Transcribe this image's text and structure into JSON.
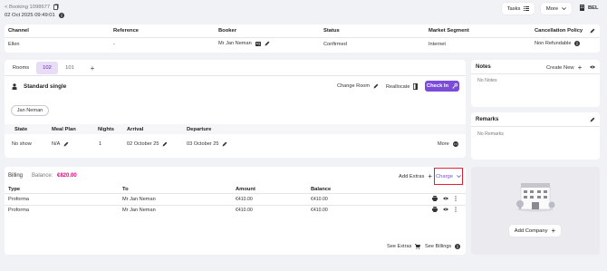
{
  "header": {
    "back_link": "< Booking 1098677",
    "datetime": "02 Oct 2025 09:49:01",
    "tasks_label": "Tasks",
    "more_label": "More",
    "lang": "BEL"
  },
  "summary": {
    "columns": [
      "Channel",
      "Reference",
      "Booker",
      "Status",
      "Market Segment",
      "Cancellation Policy"
    ],
    "values": {
      "channel": "Ellen",
      "reference": "-",
      "booker": "Mr Jan Neman",
      "status": "Confirmed",
      "market_segment": "Internet",
      "cancellation_policy": "Non Refundable"
    }
  },
  "rooms": {
    "tabs": [
      "Rooms",
      "102",
      "101",
      "+"
    ],
    "room_type": "Standard single",
    "change_room_label": "Change Room",
    "reallocate_label": "Reallocate",
    "checkin_label": "Check In",
    "guest_chip": "Jan Neman",
    "columns": [
      "State",
      "Meal Plan",
      "Nights",
      "Arrival",
      "Departure"
    ],
    "row": {
      "state": "No show",
      "meal_plan": "N/A",
      "nights": "1",
      "arrival": "02 October 25",
      "departure": "03 October 25",
      "more_label": "More"
    }
  },
  "notes": {
    "title": "Notes",
    "create_label": "Create New",
    "empty": "No Notes"
  },
  "remarks": {
    "title": "Remarks",
    "empty": "No Remarks"
  },
  "billing": {
    "title": "Billing",
    "balance_label": "Balance:",
    "balance_value": "€820.00",
    "add_extras_label": "Add Extras",
    "charge_label": "Charge",
    "columns": [
      "Type",
      "To",
      "Amount",
      "Balance"
    ],
    "rows": [
      {
        "type": "Proforma",
        "to": "Mr Jan Neman",
        "amount": "€410.00",
        "balance": "€410.00"
      },
      {
        "type": "Proforma",
        "to": "Mr Jan Neman",
        "amount": "€410.00",
        "balance": "€410.00"
      }
    ],
    "see_extras_label": "See Extras",
    "see_billings_label": "See Billings"
  },
  "company": {
    "add_label": "Add Company"
  },
  "colors": {
    "accent": "#e5007d",
    "tab_active_bg": "#e9dcf7",
    "checkin_bg": "#7a4cd9",
    "highlight_border": "#e0202e"
  }
}
